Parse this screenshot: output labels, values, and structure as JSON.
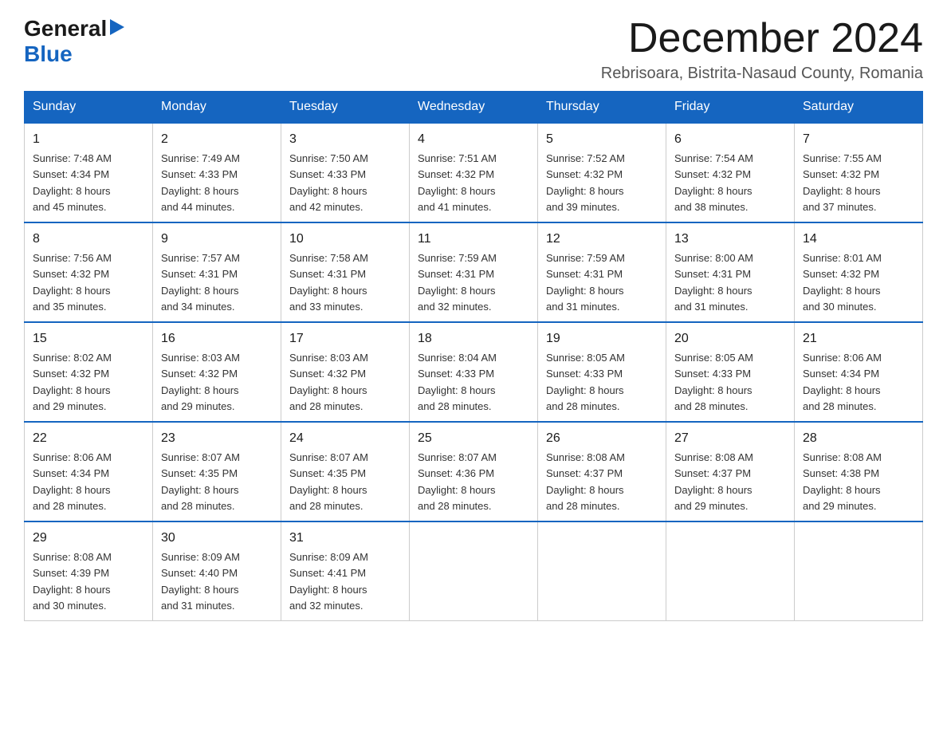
{
  "logo": {
    "general": "General",
    "blue": "Blue",
    "arrow": "▶"
  },
  "title": "December 2024",
  "subtitle": "Rebrisoara, Bistrita-Nasaud County, Romania",
  "headers": [
    "Sunday",
    "Monday",
    "Tuesday",
    "Wednesday",
    "Thursday",
    "Friday",
    "Saturday"
  ],
  "weeks": [
    [
      {
        "day": "1",
        "sunrise": "7:48 AM",
        "sunset": "4:34 PM",
        "daylight": "8 hours and 45 minutes."
      },
      {
        "day": "2",
        "sunrise": "7:49 AM",
        "sunset": "4:33 PM",
        "daylight": "8 hours and 44 minutes."
      },
      {
        "day": "3",
        "sunrise": "7:50 AM",
        "sunset": "4:33 PM",
        "daylight": "8 hours and 42 minutes."
      },
      {
        "day": "4",
        "sunrise": "7:51 AM",
        "sunset": "4:32 PM",
        "daylight": "8 hours and 41 minutes."
      },
      {
        "day": "5",
        "sunrise": "7:52 AM",
        "sunset": "4:32 PM",
        "daylight": "8 hours and 39 minutes."
      },
      {
        "day": "6",
        "sunrise": "7:54 AM",
        "sunset": "4:32 PM",
        "daylight": "8 hours and 38 minutes."
      },
      {
        "day": "7",
        "sunrise": "7:55 AM",
        "sunset": "4:32 PM",
        "daylight": "8 hours and 37 minutes."
      }
    ],
    [
      {
        "day": "8",
        "sunrise": "7:56 AM",
        "sunset": "4:32 PM",
        "daylight": "8 hours and 35 minutes."
      },
      {
        "day": "9",
        "sunrise": "7:57 AM",
        "sunset": "4:31 PM",
        "daylight": "8 hours and 34 minutes."
      },
      {
        "day": "10",
        "sunrise": "7:58 AM",
        "sunset": "4:31 PM",
        "daylight": "8 hours and 33 minutes."
      },
      {
        "day": "11",
        "sunrise": "7:59 AM",
        "sunset": "4:31 PM",
        "daylight": "8 hours and 32 minutes."
      },
      {
        "day": "12",
        "sunrise": "7:59 AM",
        "sunset": "4:31 PM",
        "daylight": "8 hours and 31 minutes."
      },
      {
        "day": "13",
        "sunrise": "8:00 AM",
        "sunset": "4:31 PM",
        "daylight": "8 hours and 31 minutes."
      },
      {
        "day": "14",
        "sunrise": "8:01 AM",
        "sunset": "4:32 PM",
        "daylight": "8 hours and 30 minutes."
      }
    ],
    [
      {
        "day": "15",
        "sunrise": "8:02 AM",
        "sunset": "4:32 PM",
        "daylight": "8 hours and 29 minutes."
      },
      {
        "day": "16",
        "sunrise": "8:03 AM",
        "sunset": "4:32 PM",
        "daylight": "8 hours and 29 minutes."
      },
      {
        "day": "17",
        "sunrise": "8:03 AM",
        "sunset": "4:32 PM",
        "daylight": "8 hours and 28 minutes."
      },
      {
        "day": "18",
        "sunrise": "8:04 AM",
        "sunset": "4:33 PM",
        "daylight": "8 hours and 28 minutes."
      },
      {
        "day": "19",
        "sunrise": "8:05 AM",
        "sunset": "4:33 PM",
        "daylight": "8 hours and 28 minutes."
      },
      {
        "day": "20",
        "sunrise": "8:05 AM",
        "sunset": "4:33 PM",
        "daylight": "8 hours and 28 minutes."
      },
      {
        "day": "21",
        "sunrise": "8:06 AM",
        "sunset": "4:34 PM",
        "daylight": "8 hours and 28 minutes."
      }
    ],
    [
      {
        "day": "22",
        "sunrise": "8:06 AM",
        "sunset": "4:34 PM",
        "daylight": "8 hours and 28 minutes."
      },
      {
        "day": "23",
        "sunrise": "8:07 AM",
        "sunset": "4:35 PM",
        "daylight": "8 hours and 28 minutes."
      },
      {
        "day": "24",
        "sunrise": "8:07 AM",
        "sunset": "4:35 PM",
        "daylight": "8 hours and 28 minutes."
      },
      {
        "day": "25",
        "sunrise": "8:07 AM",
        "sunset": "4:36 PM",
        "daylight": "8 hours and 28 minutes."
      },
      {
        "day": "26",
        "sunrise": "8:08 AM",
        "sunset": "4:37 PM",
        "daylight": "8 hours and 28 minutes."
      },
      {
        "day": "27",
        "sunrise": "8:08 AM",
        "sunset": "4:37 PM",
        "daylight": "8 hours and 29 minutes."
      },
      {
        "day": "28",
        "sunrise": "8:08 AM",
        "sunset": "4:38 PM",
        "daylight": "8 hours and 29 minutes."
      }
    ],
    [
      {
        "day": "29",
        "sunrise": "8:08 AM",
        "sunset": "4:39 PM",
        "daylight": "8 hours and 30 minutes."
      },
      {
        "day": "30",
        "sunrise": "8:09 AM",
        "sunset": "4:40 PM",
        "daylight": "8 hours and 31 minutes."
      },
      {
        "day": "31",
        "sunrise": "8:09 AM",
        "sunset": "4:41 PM",
        "daylight": "8 hours and 32 minutes."
      },
      null,
      null,
      null,
      null
    ]
  ],
  "labels": {
    "sunrise": "Sunrise:",
    "sunset": "Sunset:",
    "daylight": "Daylight:"
  }
}
